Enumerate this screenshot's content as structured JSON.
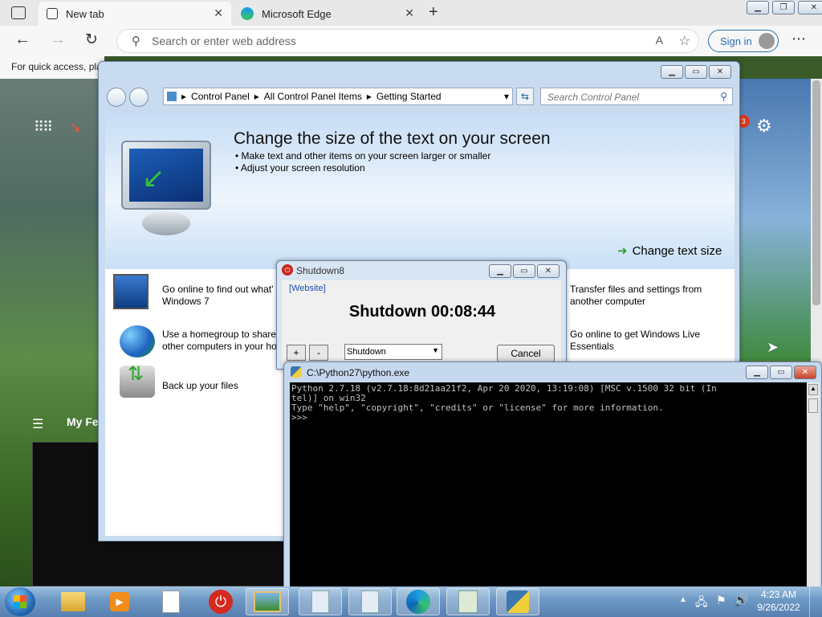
{
  "edge": {
    "tabs": [
      {
        "label": "New tab"
      },
      {
        "label": "Microsoft Edge"
      }
    ],
    "address_placeholder": "Search or enter web address",
    "sign_in": "Sign in",
    "favorites_hint": "For quick access, pla",
    "notification_count": "3",
    "feed_label": "My Fe"
  },
  "control_panel": {
    "breadcrumb": [
      "Control Panel",
      "All Control Panel Items",
      "Getting Started"
    ],
    "search_placeholder": "Search Control Panel",
    "banner": {
      "title": "Change the size of the text on your screen",
      "bullets": [
        "Make text and other items on your screen larger or smaller",
        "Adjust your screen resolution"
      ],
      "action": "Change text size"
    },
    "items": [
      {
        "text": "Go online to find out what' Windows 7"
      },
      {
        "text": "Use a homegroup to share other computers in your ho"
      },
      {
        "text": "Back up your files"
      },
      {
        "text": "Transfer files and settings from another computer"
      },
      {
        "text": "Go online to get Windows Live Essentials"
      }
    ]
  },
  "shutdown8": {
    "title": "Shutdown8",
    "website_link": "[Website]",
    "countdown": "Shutdown 00:08:44",
    "plus": "+",
    "minus": "-",
    "action_selected": "Shutdown",
    "cancel": "Cancel"
  },
  "python": {
    "title": "C:\\Python27\\python.exe",
    "lines": [
      "Python 2.7.18 (v2.7.18:8d21aa21f2, Apr 20 2020, 13:19:08) [MSC v.1500 32 bit (In",
      "tel)] on win32",
      "Type \"help\", \"copyright\", \"credits\" or \"license\" for more information.",
      ">>>"
    ]
  },
  "taskbar": {
    "time": "4:23 AM",
    "date": "9/26/2022"
  }
}
